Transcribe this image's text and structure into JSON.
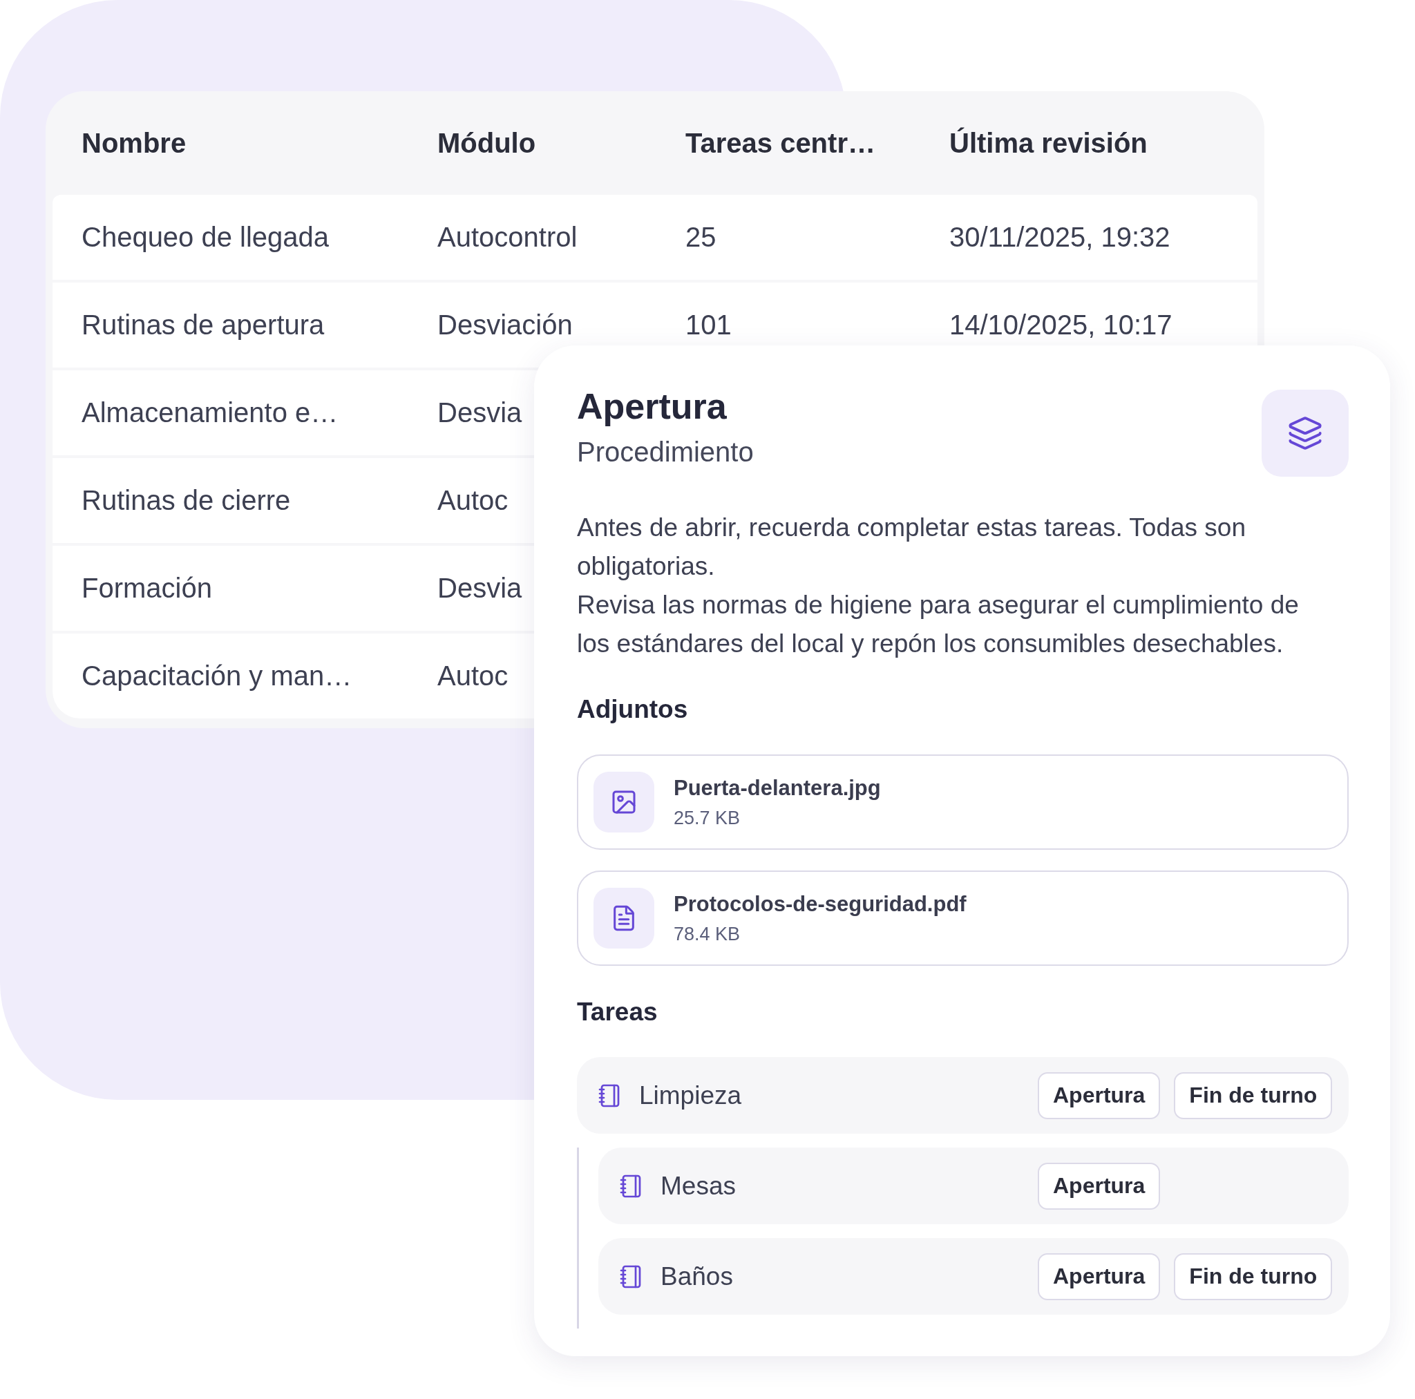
{
  "table": {
    "columns": [
      "Nombre",
      "Módulo",
      "Tareas centr…",
      "Última revisión"
    ],
    "rows": [
      {
        "cells": [
          "Chequeo de llegada",
          "Autocontrol",
          "25",
          "30/11/2025, 19:32"
        ]
      },
      {
        "cells": [
          "Rutinas de apertura",
          "Desviación",
          "101",
          "14/10/2025, 10:17"
        ]
      },
      {
        "cells": [
          "Almacenamiento e…",
          "Desvia"
        ]
      },
      {
        "cells": [
          "Rutinas de cierre",
          "Autoc"
        ]
      },
      {
        "cells": [
          "Formación",
          "Desvia"
        ]
      },
      {
        "cells": [
          "Capacitación y man…",
          "Autoc"
        ]
      }
    ]
  },
  "detail": {
    "title": "Apertura",
    "subtitle": "Procedimiento",
    "description": [
      "Antes de abrir, recuerda completar estas tareas. Todas son obligatorias.",
      "Revisa las normas de higiene para asegurar el cumplimiento de los estándares del local y repón los consumibles desechables."
    ],
    "attachments_heading": "Adjuntos",
    "attachments": [
      {
        "kind": "image",
        "name": "Puerta-delantera.jpg",
        "size": "25.7 KB"
      },
      {
        "kind": "pdf",
        "name": "Protocolos-de-seguridad.pdf",
        "size": "78.4 KB"
      }
    ],
    "tasks_heading": "Tareas",
    "tasks": [
      {
        "name": "Limpieza",
        "tags": [
          "Apertura",
          "Fin de turno"
        ],
        "children": [
          {
            "name": "Mesas",
            "tags": [
              "Apertura"
            ]
          },
          {
            "name": "Baños",
            "tags": [
              "Apertura",
              "Fin de turno"
            ]
          }
        ]
      }
    ]
  }
}
